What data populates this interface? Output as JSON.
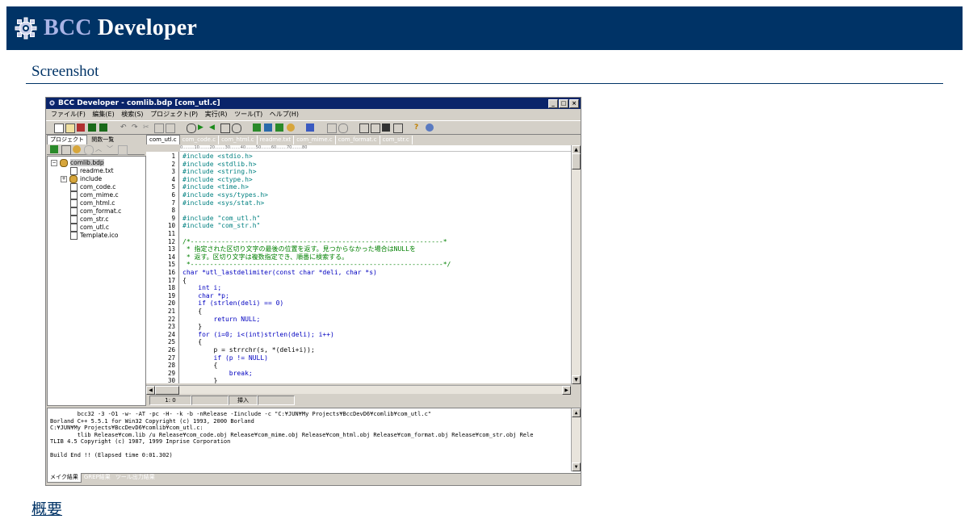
{
  "header": {
    "brand_accent": "BCC",
    "brand_main": "Developer",
    "logo_icon": "gear-icon",
    "bg_color": "#003366"
  },
  "section": {
    "title": "Screenshot"
  },
  "next_link": "概要",
  "window": {
    "title": "BCC Developer - comlib.bdp [com_utl.c]",
    "menu": [
      "ファイル(F)",
      "編集(E)",
      "検索(S)",
      "プロジェクト(P)",
      "実行(R)",
      "ツール(T)",
      "ヘルプ(H)"
    ],
    "project_tabs": [
      "プロジェクト",
      "関数一覧"
    ],
    "tree": {
      "root": "comlib.bdp",
      "items": [
        "readme.txt",
        "include",
        "com_code.c",
        "com_mime.c",
        "com_html.c",
        "com_format.c",
        "com_str.c",
        "com_utl.c",
        "Template.ico"
      ]
    },
    "file_tabs": [
      "com_utl.c",
      "com_code.c",
      "com_html.c",
      "readme.txt",
      "com_mime.c",
      "com_format.c",
      "com_str.c"
    ],
    "ruler": "0.........10........20........30........40........50........60........70........80",
    "code_lines": [
      "#include <stdio.h>",
      "#include <stdlib.h>",
      "#include <string.h>",
      "#include <ctype.h>",
      "#include <time.h>",
      "#include <sys/types.h>",
      "#include <sys/stat.h>",
      "",
      "#include \"com_utl.h\"",
      "#include \"com_str.h\"",
      "",
      "/*-----------------------------------------------------------------*",
      " * 指定された区切り文字の最後の位置を返す。見つからなかった場合はNULLを",
      " * 返す。区切り文字は複数指定でき、順番に検索する。",
      " *-----------------------------------------------------------------*/",
      "char *utl_lastdelimiter(const char *deli, char *s)",
      "{",
      "    int i;",
      "    char *p;",
      "    if (strlen(deli) == 0)",
      "    {",
      "        return NULL;",
      "    }",
      "    for (i=0; i<(int)strlen(deli); i++)",
      "    {",
      "        p = strrchr(s, *(deli+i));",
      "        if (p != NULL)",
      "        {",
      "            break;",
      "        }"
    ],
    "status": {
      "pos": "1:   0",
      "mode": "挿入"
    },
    "output_lines": [
      "        bcc32 -3 -O1 -w- -AT -pc -H- -k -b -nRelease -Iinclude -c \"C:¥JUN¥My Projects¥BccDevD6¥comlib¥com_utl.c\"",
      "Borland C++ 5.5.1 for Win32 Copyright (c) 1993, 2000 Borland",
      "C:¥JUN¥My Projects¥BccDevD6¥comlib¥com_utl.c:",
      "        tlib Release¥com.lib /u Release¥com_code.obj Release¥com_mime.obj Release¥com_html.obj Release¥com_format.obj Release¥com_str.obj Rele",
      "TLIB 4.5 Copyright (c) 1987, 1999 Inprise Corporation",
      "",
      "Build End !! (Elapsed time 0:01.302)"
    ],
    "output_tabs": [
      "メイク結果",
      "GREP結果",
      "ツール出力結果"
    ]
  }
}
